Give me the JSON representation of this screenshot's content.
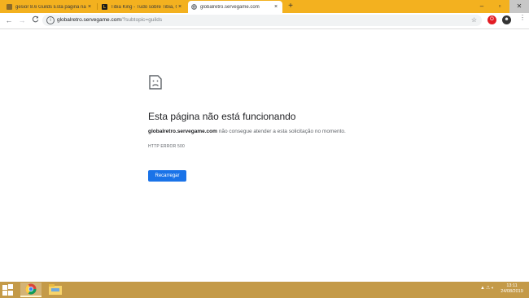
{
  "colors": {
    "tabstrip": "#f3b11f",
    "taskbar": "#c49a48",
    "accent": "#1a73e8"
  },
  "tabs": [
    {
      "title": "gesior 8.6 Guilds Esta página nã...",
      "favicon": "gesior-favicon",
      "close": "×",
      "active": false
    },
    {
      "title": "Tibia King - Tudo sobre Tibia, OT",
      "favicon": "tibiaking-favicon",
      "favicon_text": "L",
      "close": "×",
      "active": false
    },
    {
      "title": "globalretro.servegame.com",
      "favicon": "globe-icon",
      "close": "×",
      "active": true
    }
  ],
  "new_tab": "+",
  "window_controls": {
    "minimize": "–",
    "maximize": "▫",
    "close": "✕"
  },
  "address": {
    "host": "globalretro.servegame.com",
    "path": "/?subtopic=guilds",
    "star": "☆"
  },
  "nav": {
    "back": "←",
    "forward": "→",
    "reload": "C"
  },
  "error": {
    "title": "Esta página não está funcionando",
    "host": "globalretro.servegame.com",
    "description_rest": " não consegue atender a esta solicitação no momento.",
    "code": "HTTP ERROR 500",
    "button": "Recarregar"
  },
  "clock": {
    "time": "13:11",
    "date": "24/08/2019"
  },
  "tray": "▲ ⎍ ◂"
}
